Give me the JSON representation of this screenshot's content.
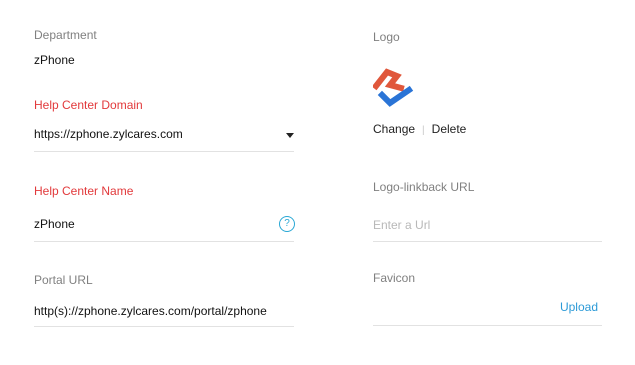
{
  "department": {
    "label": "Department",
    "value": "zPhone"
  },
  "help_center_domain": {
    "label": "Help Center Domain",
    "value": "https://zphone.zylcares.com"
  },
  "help_center_name": {
    "label": "Help Center Name",
    "value": "zPhone",
    "help_icon_text": "?"
  },
  "portal_url": {
    "label": "Portal URL",
    "value": "http(s)://zphone.zylcares.com/portal/zphone"
  },
  "logo": {
    "label": "Logo",
    "change_label": "Change",
    "separator": "|",
    "delete_label": "Delete",
    "colors": {
      "orange": "#e0573b",
      "blue": "#2a74d6"
    }
  },
  "logo_linkback_url": {
    "label": "Logo-linkback URL",
    "placeholder": "Enter a Url"
  },
  "favicon": {
    "label": "Favicon",
    "upload_label": "Upload"
  },
  "colors": {
    "required_label": "#e2393b",
    "link": "#2c9ad7",
    "divider": "#e2e2e2"
  }
}
